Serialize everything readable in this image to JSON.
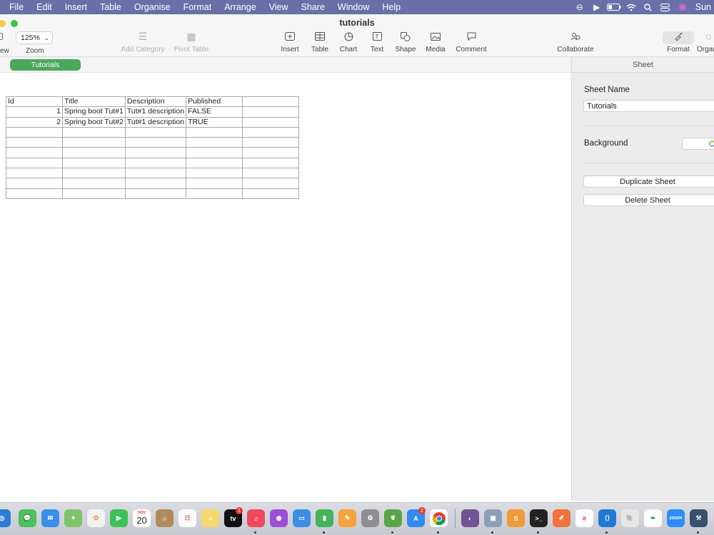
{
  "menubar": {
    "items": [
      "File",
      "Edit",
      "Insert",
      "Table",
      "Organise",
      "Format",
      "Arrange",
      "View",
      "Share",
      "Window",
      "Help"
    ],
    "clock": "Sun"
  },
  "window": {
    "title": "tutorials"
  },
  "toolbar": {
    "view_label": "ew",
    "zoom_value": "125%",
    "zoom_label": "Zoom",
    "add_category": "Add Category",
    "pivot_table": "Pivot Table",
    "insert": "Insert",
    "table": "Table",
    "chart": "Chart",
    "text": "Text",
    "shape": "Shape",
    "media": "Media",
    "comment": "Comment",
    "collaborate": "Collaborate",
    "format": "Format",
    "organise": "Organ"
  },
  "sheet_tabs": [
    {
      "label": "Tutorials",
      "active": true
    }
  ],
  "table": {
    "headers": [
      "Id",
      "Title",
      "Description",
      "Published",
      ""
    ],
    "rows": [
      [
        "1",
        "Spring boot Tut#1",
        "Tut#1 description",
        "FALSE",
        ""
      ],
      [
        "2",
        "Spring boot Tut#2",
        "Tut#1 description",
        "TRUE",
        ""
      ]
    ],
    "empty_rows": 7
  },
  "inspector": {
    "tab": "Sheet",
    "sheet_name_label": "Sheet Name",
    "sheet_name_value": "Tutorials",
    "background_label": "Background",
    "duplicate_button": "Duplicate Sheet",
    "delete_button": "Delete Sheet"
  },
  "dock": {
    "calendar_month": "NOV",
    "calendar_day": "20",
    "tv_badge": "1",
    "appstore_badge": "2",
    "zoom_label": "zoom"
  },
  "colors": {
    "menubar": "#6b6fa8",
    "accent_green": "#4ca75e",
    "traffic_red": "#f7c948",
    "traffic_green": "#34c749"
  }
}
